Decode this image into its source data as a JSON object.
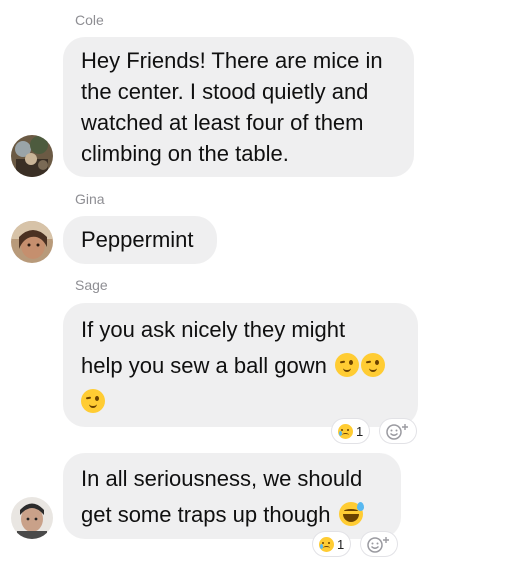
{
  "messages": [
    {
      "sender": "Cole",
      "lines": [
        "Hey Friends! There are mice in",
        "the center. I stood quietly and",
        "watched at least four of them",
        "climbing on the table."
      ]
    },
    {
      "sender": "Gina",
      "lines": [
        "Peppermint"
      ]
    },
    {
      "sender": "Sage",
      "lines": [
        "If you ask nicely they might",
        "help you sew a ball gown"
      ],
      "emojis": [
        "winking-face",
        "winking-face",
        "winking-face"
      ],
      "reaction": {
        "emoji": "sad-tear-face",
        "count": "1"
      }
    },
    {
      "sender": "",
      "lines": [
        "In all seriousness, we should",
        "get some traps up though"
      ],
      "emojis": [
        "grinning-sweat-face"
      ],
      "reaction": {
        "emoji": "sad-tear-face",
        "count": "1"
      }
    }
  ]
}
